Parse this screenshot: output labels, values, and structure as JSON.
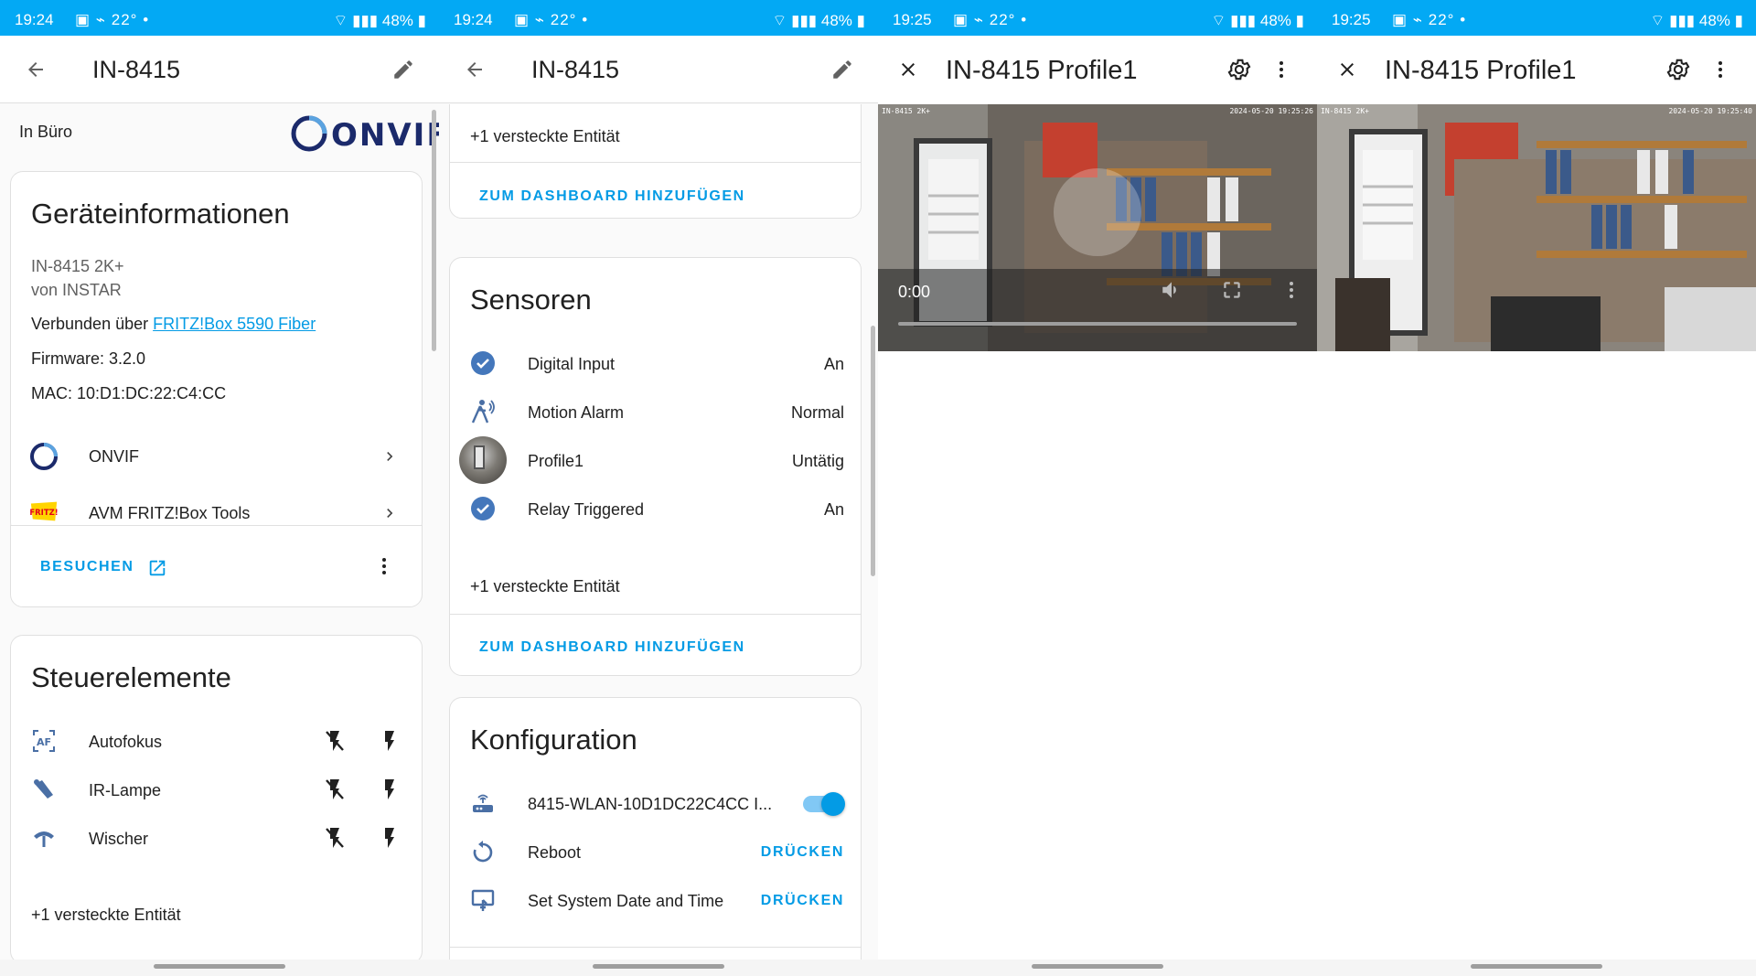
{
  "status": [
    {
      "time": "19:24",
      "temp": "22°",
      "battery": "48%"
    },
    {
      "time": "19:24",
      "temp": "22°",
      "battery": "48%"
    },
    {
      "time": "19:25",
      "temp": "22°",
      "battery": "48%"
    },
    {
      "time": "19:25",
      "temp": "22°",
      "battery": "48%"
    }
  ],
  "colors": {
    "accent": "#03a9f4",
    "link": "#039be5",
    "onvif_blue": "#1b2a6b",
    "check": "#4477bb"
  },
  "panel1": {
    "title": "IN-8415",
    "area": "In Büro",
    "logo": "ONVIF",
    "device_info": {
      "heading": "Geräteinformationen",
      "model": "IN-8415 2K+",
      "manufacturer": "von INSTAR",
      "connected_prefix": "Verbunden über",
      "connected_link": "FRITZ!Box 5590 Fiber",
      "firmware": "Firmware: 3.2.0",
      "mac": "MAC: 10:D1:DC:22:C4:CC",
      "integrations": [
        {
          "label": "ONVIF",
          "icon": "onvif-ring-icon"
        },
        {
          "label": "AVM FRITZ!Box Tools",
          "icon": "fritz-logo-icon"
        }
      ],
      "visit": "BESUCHEN"
    },
    "controls": {
      "heading": "Steuerelemente",
      "items": [
        {
          "label": "Autofokus",
          "icon": "af-icon"
        },
        {
          "label": "IR-Lampe",
          "icon": "ir-lamp-icon"
        },
        {
          "label": "Wischer",
          "icon": "wiper-icon"
        }
      ],
      "hidden": "+1 versteckte Entität"
    }
  },
  "panel2": {
    "title": "IN-8415",
    "top_card": {
      "hidden": "+1 versteckte Entität",
      "dashboard": "ZUM DASHBOARD HINZUFÜGEN"
    },
    "sensors": {
      "heading": "Sensoren",
      "items": [
        {
          "label": "Digital Input",
          "state": "An",
          "icon": "check-circle-icon"
        },
        {
          "label": "Motion Alarm",
          "state": "Normal",
          "icon": "motion-sensor-icon"
        },
        {
          "label": "Profile1",
          "state": "Untätig",
          "icon": "camera-thumbnail"
        },
        {
          "label": "Relay Triggered",
          "state": "An",
          "icon": "check-circle-icon"
        }
      ],
      "hidden": "+1 versteckte Entität",
      "dashboard": "ZUM DASHBOARD HINZUFÜGEN"
    },
    "config": {
      "heading": "Konfiguration",
      "wlan": "8415-WLAN-10D1DC22C4CC I...",
      "wlan_on": true,
      "reboot": "Reboot",
      "reboot_btn": "DRÜCKEN",
      "settime": "Set System Date and Time",
      "settime_btn": "DRÜCKEN"
    }
  },
  "panel3": {
    "title": "IN-8415 Profile1",
    "osd_left": "IN-8415 2K+",
    "osd_right": "2024-05-20 19:25:26",
    "time": "0:00"
  },
  "panel4": {
    "title": "IN-8415 Profile1",
    "osd_left": "IN-8415 2K+",
    "osd_right": "2024-05-20 19:25:40"
  }
}
